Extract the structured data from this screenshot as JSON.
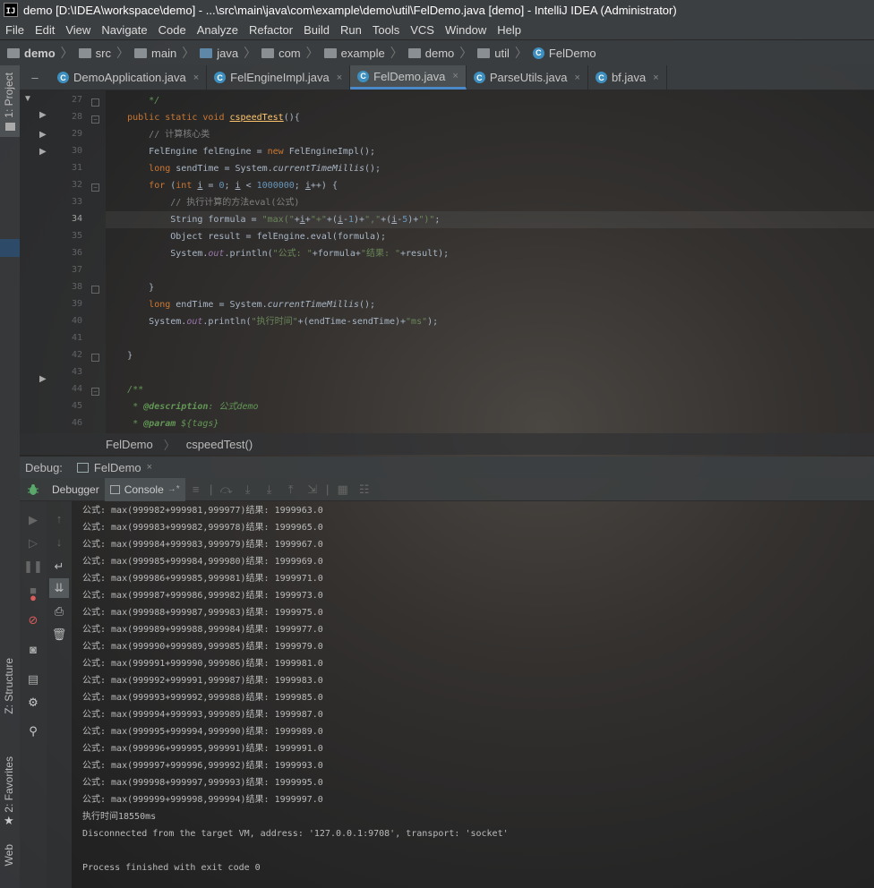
{
  "window": {
    "title": "demo [D:\\IDEA\\workspace\\demo] - ...\\src\\main\\java\\com\\example\\demo\\util\\FelDemo.java [demo] - IntelliJ IDEA (Administrator)",
    "logo": "IJ"
  },
  "menu": [
    "File",
    "Edit",
    "View",
    "Navigate",
    "Code",
    "Analyze",
    "Refactor",
    "Build",
    "Run",
    "Tools",
    "VCS",
    "Window",
    "Help"
  ],
  "breadcrumb": [
    "demo",
    "src",
    "main",
    "java",
    "com",
    "example",
    "demo",
    "util",
    "FelDemo"
  ],
  "side_tools": {
    "project": "1: Project",
    "structure": "Z: Structure",
    "favorites": "2: Favorites",
    "web": "Web"
  },
  "tabs": [
    {
      "label": "DemoApplication.java",
      "active": false
    },
    {
      "label": "FelEngineImpl.java",
      "active": false
    },
    {
      "label": "FelDemo.java",
      "active": true
    },
    {
      "label": "ParseUtils.java",
      "active": false
    },
    {
      "label": "bf.java",
      "active": false
    }
  ],
  "tab_close": "×",
  "line_numbers": [
    "27",
    "28",
    "29",
    "30",
    "31",
    "32",
    "33",
    "34",
    "35",
    "36",
    "37",
    "38",
    "39",
    "40",
    "41",
    "42",
    "43",
    "44",
    "45",
    "46"
  ],
  "code_breadcrumb": {
    "class": "FelDemo",
    "method": "cspeedTest()"
  },
  "debug": {
    "label": "Debug:",
    "config": "FelDemo",
    "close": "×"
  },
  "debug_tabs": {
    "debugger": "Debugger",
    "console": "Console",
    "console_suffix": "→*"
  },
  "console_lines": [
    "公式: max(999982+999981,999977)结果: 1999963.0",
    "公式: max(999983+999982,999978)结果: 1999965.0",
    "公式: max(999984+999983,999979)结果: 1999967.0",
    "公式: max(999985+999984,999980)结果: 1999969.0",
    "公式: max(999986+999985,999981)结果: 1999971.0",
    "公式: max(999987+999986,999982)结果: 1999973.0",
    "公式: max(999988+999987,999983)结果: 1999975.0",
    "公式: max(999989+999988,999984)结果: 1999977.0",
    "公式: max(999990+999989,999985)结果: 1999979.0",
    "公式: max(999991+999990,999986)结果: 1999981.0",
    "公式: max(999992+999991,999987)结果: 1999983.0",
    "公式: max(999993+999992,999988)结果: 1999985.0",
    "公式: max(999994+999993,999989)结果: 1999987.0",
    "公式: max(999995+999994,999990)结果: 1999989.0",
    "公式: max(999996+999995,999991)结果: 1999991.0",
    "公式: max(999997+999996,999992)结果: 1999993.0",
    "公式: max(999998+999997,999993)结果: 1999995.0",
    "公式: max(999999+999998,999994)结果: 1999997.0",
    "执行时间18550ms",
    "Disconnected from the target VM, address: '127.0.0.1:9708', transport: 'socket'",
    "",
    "Process finished with exit code 0"
  ],
  "colors": {
    "keyword": "#cc7832",
    "string": "#6a8759",
    "number": "#6897bb",
    "comment": "#808080",
    "doc": "#629755",
    "method": "#ffc66d",
    "static_field": "#9876aa",
    "accent": "#4a88c7",
    "debug_green": "#59a869",
    "stop_red": "#db5c5c"
  }
}
